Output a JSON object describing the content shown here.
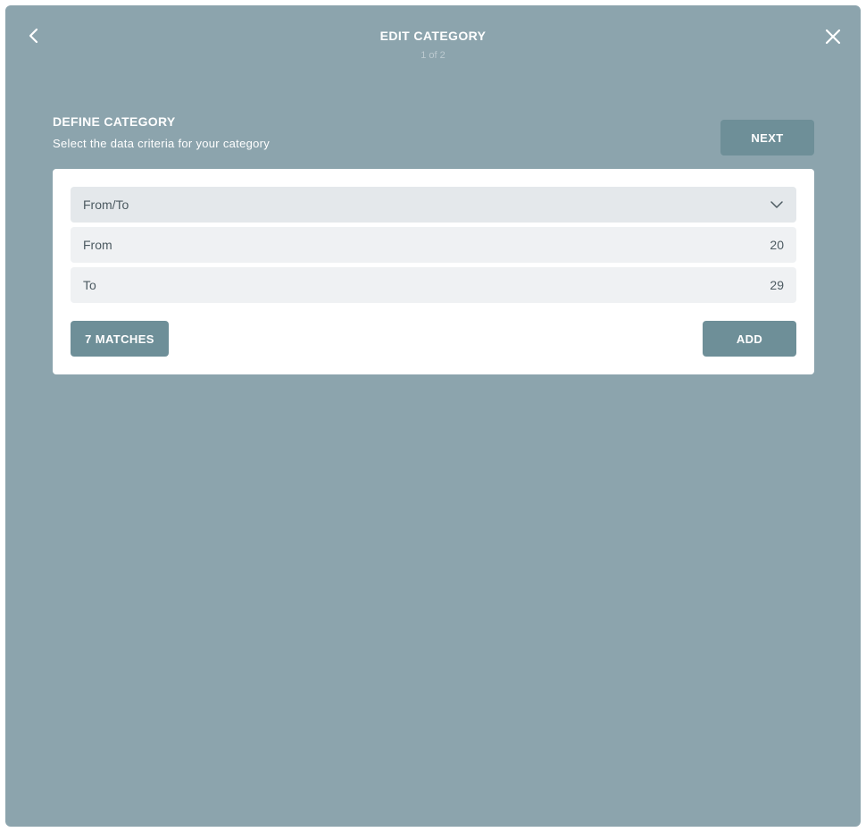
{
  "header": {
    "title": "EDIT CATEGORY",
    "step": "1 of 2",
    "back_icon": "chevron-left-icon",
    "close_icon": "close-icon"
  },
  "section": {
    "title": "DEFINE CATEGORY",
    "subtitle": "Select the data criteria for your category",
    "next_label": "NEXT"
  },
  "criteria": {
    "select": {
      "value": "From/To",
      "icon": "chevron-down-icon"
    },
    "from": {
      "label": "From",
      "value": "20"
    },
    "to": {
      "label": "To",
      "value": "29"
    },
    "matches_label": "7 MATCHES",
    "add_label": "ADD"
  },
  "colors": {
    "modal_background": "#8ca4ad",
    "button": "#6e8f98",
    "card": "#ffffff",
    "select_background": "#e4e8eb",
    "field_background": "#eff1f3",
    "text_dark": "#4c5a61"
  }
}
